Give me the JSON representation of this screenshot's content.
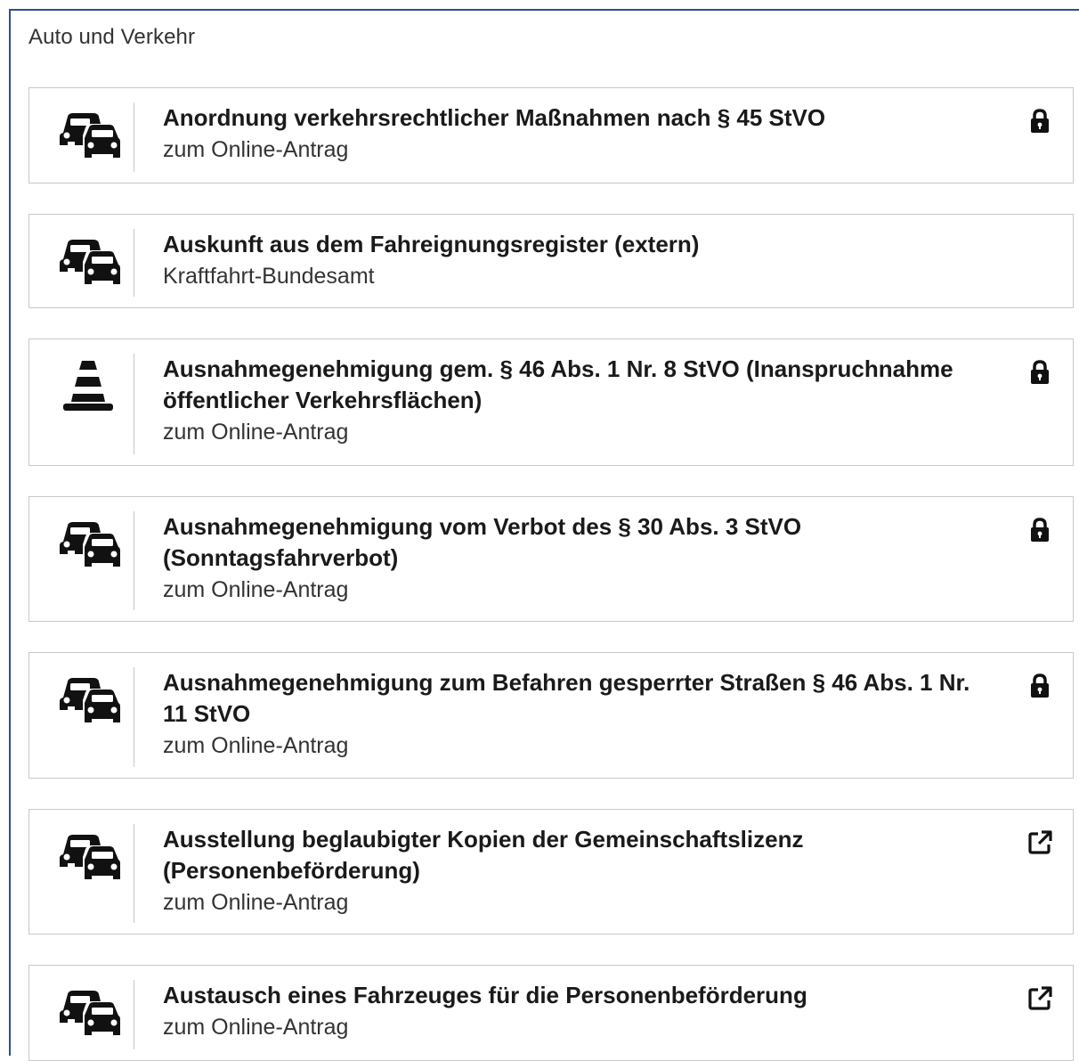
{
  "section": {
    "title": "Auto und Verkehr"
  },
  "items": [
    {
      "icon": "cars-icon",
      "title": "Anordnung verkehrsrechtlicher Maßnahmen nach § 45 StVO",
      "subtitle": "zum Online-Antrag",
      "action_icon": "lock-icon"
    },
    {
      "icon": "cars-icon",
      "title": "Auskunft aus dem Fahreignungsregister (extern)",
      "subtitle": "Kraftfahrt-Bundesamt",
      "action_icon": ""
    },
    {
      "icon": "traffic-cone-icon",
      "title": "Ausnahmegenehmigung gem. § 46 Abs. 1 Nr. 8 StVO (Inanspruch­nahme öffentlicher Verkehrsflächen)",
      "subtitle": "zum Online-Antrag",
      "action_icon": "lock-icon"
    },
    {
      "icon": "cars-icon",
      "title": "Ausnahmegenehmigung vom Verbot des § 30 Abs. 3 StVO (Sonntagsfahrverbot)",
      "subtitle": "zum Online-Antrag",
      "action_icon": "lock-icon"
    },
    {
      "icon": "cars-icon",
      "title": "Ausnahmegenehmigung zum Befahren gesperrter Straßen § 46 Abs. 1 Nr. 11 StVO",
      "subtitle": "zum Online-Antrag",
      "action_icon": "lock-icon"
    },
    {
      "icon": "cars-icon",
      "title": "Ausstellung beglaubigter Kopien der Gemeinschaftslizenz (Personenbeförderung)",
      "subtitle": "zum Online-Antrag",
      "action_icon": "external-link-icon"
    },
    {
      "icon": "cars-icon",
      "title": "Austausch eines Fahrzeuges für die Personenbeförderung",
      "subtitle": "zum Online-Antrag",
      "action_icon": "external-link-icon"
    }
  ],
  "colors": {
    "panel_border": "#2c4f8a",
    "item_border": "#c8c8c8",
    "text": "#1a1a1a"
  }
}
